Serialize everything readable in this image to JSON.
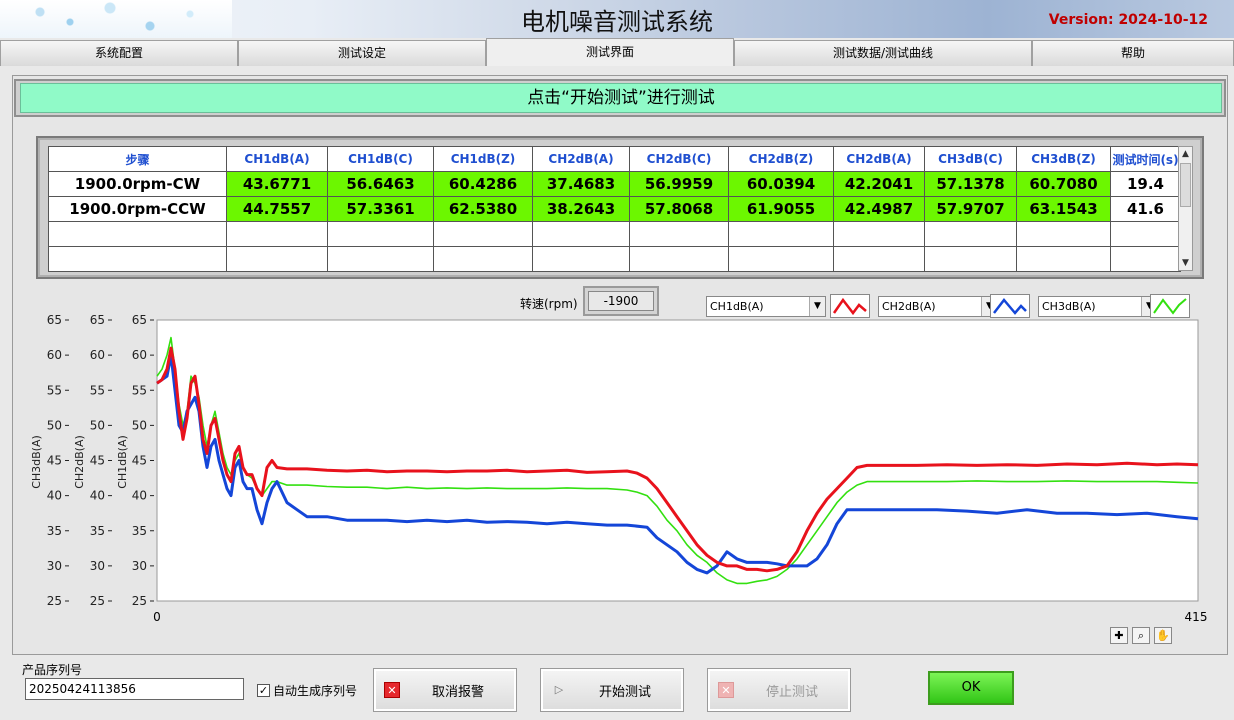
{
  "header": {
    "title": "电机噪音测试系统",
    "version": "Version: 2024-10-12"
  },
  "tabs": [
    {
      "label": "系统配置",
      "active": false
    },
    {
      "label": "测试设定",
      "active": false
    },
    {
      "label": "测试界面",
      "active": true
    },
    {
      "label": "测试数据/测试曲线",
      "active": false
    },
    {
      "label": "帮助",
      "active": false
    }
  ],
  "banner": "点击“开始测试”进行测试",
  "table": {
    "headers": [
      "步骤",
      "CH1dB(A)",
      "CH1dB(C)",
      "CH1dB(Z)",
      "CH2dB(A)",
      "CH2dB(C)",
      "CH2dB(Z)",
      "CH2dB(A)",
      "CH3dB(C)",
      "CH3dB(Z)",
      "测试时间(s)"
    ],
    "rows": [
      [
        "1900.0rpm-CW",
        "43.6771",
        "56.6463",
        "60.4286",
        "37.4683",
        "56.9959",
        "60.0394",
        "42.2041",
        "57.1378",
        "60.7080",
        "19.4"
      ],
      [
        "1900.0rpm-CCW",
        "44.7557",
        "57.3361",
        "62.5380",
        "38.2643",
        "57.8068",
        "61.9055",
        "42.4987",
        "57.9707",
        "63.1543",
        "41.6"
      ]
    ]
  },
  "speed": {
    "label": "转速(rpm)",
    "value": "-1900"
  },
  "selectors": [
    {
      "value": "CH1dB(A)",
      "color": "#e8121c"
    },
    {
      "value": "CH2dB(A)",
      "color": "#1446d8"
    },
    {
      "value": "CH3dB(A)",
      "color": "#33e010"
    }
  ],
  "chart_data": {
    "type": "line",
    "xlim": [
      0,
      415
    ],
    "ylim": [
      25,
      65
    ],
    "x_ticks": [
      "0",
      "415"
    ],
    "y_ticks": [
      "25",
      "30",
      "35",
      "40",
      "45",
      "50",
      "55",
      "60",
      "65"
    ],
    "y_axes": [
      "CH3dB(A)",
      "CH2dB(A)",
      "CH1dB(A)"
    ],
    "series": [
      {
        "name": "CH1dB(A)",
        "color": "#e8121c",
        "points": [
          [
            0,
            56
          ],
          [
            5,
            56.5
          ],
          [
            10,
            58
          ],
          [
            14,
            61
          ],
          [
            18,
            58
          ],
          [
            22,
            52
          ],
          [
            26,
            48
          ],
          [
            30,
            51
          ],
          [
            34,
            56
          ],
          [
            38,
            57
          ],
          [
            42,
            53
          ],
          [
            46,
            48
          ],
          [
            50,
            46
          ],
          [
            54,
            50
          ],
          [
            58,
            51
          ],
          [
            62,
            48
          ],
          [
            66,
            45
          ],
          [
            70,
            43
          ],
          [
            74,
            42
          ],
          [
            78,
            46
          ],
          [
            82,
            47
          ],
          [
            86,
            44
          ],
          [
            90,
            43
          ],
          [
            95,
            43
          ],
          [
            100,
            41
          ],
          [
            105,
            40
          ],
          [
            110,
            44
          ],
          [
            115,
            45
          ],
          [
            120,
            44
          ],
          [
            130,
            43.8
          ],
          [
            150,
            43.8
          ],
          [
            170,
            43.6
          ],
          [
            190,
            43.5
          ],
          [
            210,
            43.6
          ],
          [
            230,
            43.4
          ],
          [
            250,
            43.5
          ],
          [
            270,
            43.5
          ],
          [
            290,
            43.4
          ],
          [
            310,
            43.5
          ],
          [
            330,
            43.5
          ],
          [
            350,
            43.6
          ],
          [
            370,
            43.4
          ],
          [
            390,
            43.5
          ],
          [
            410,
            43.6
          ],
          [
            430,
            43.3
          ],
          [
            450,
            43.4
          ],
          [
            470,
            43.5
          ],
          [
            480,
            43.2
          ],
          [
            490,
            42.5
          ],
          [
            500,
            41
          ],
          [
            510,
            39
          ],
          [
            520,
            37
          ],
          [
            530,
            35
          ],
          [
            540,
            33
          ],
          [
            550,
            31.5
          ],
          [
            560,
            30.5
          ],
          [
            570,
            30
          ],
          [
            580,
            30
          ],
          [
            590,
            29.5
          ],
          [
            600,
            29.5
          ],
          [
            610,
            29.3
          ],
          [
            620,
            29.5
          ],
          [
            630,
            30
          ],
          [
            640,
            32
          ],
          [
            650,
            35
          ],
          [
            660,
            37.5
          ],
          [
            670,
            39.5
          ],
          [
            680,
            41
          ],
          [
            690,
            42.5
          ],
          [
            700,
            44
          ],
          [
            710,
            44.3
          ],
          [
            730,
            44.3
          ],
          [
            760,
            44.3
          ],
          [
            790,
            44.4
          ],
          [
            820,
            44.3
          ],
          [
            850,
            44.4
          ],
          [
            880,
            44.3
          ],
          [
            910,
            44.5
          ],
          [
            940,
            44.4
          ],
          [
            970,
            44.6
          ],
          [
            1000,
            44.4
          ],
          [
            1020,
            44.5
          ],
          [
            1041,
            44.4
          ]
        ]
      },
      {
        "name": "CH2dB(A)",
        "color": "#1446d8",
        "points": [
          [
            0,
            56
          ],
          [
            5,
            56.5
          ],
          [
            10,
            57
          ],
          [
            14,
            60
          ],
          [
            18,
            55
          ],
          [
            22,
            50
          ],
          [
            26,
            49
          ],
          [
            30,
            52
          ],
          [
            34,
            53
          ],
          [
            38,
            54
          ],
          [
            42,
            52
          ],
          [
            46,
            47
          ],
          [
            50,
            44
          ],
          [
            54,
            47
          ],
          [
            58,
            48
          ],
          [
            62,
            45
          ],
          [
            66,
            43
          ],
          [
            70,
            41
          ],
          [
            74,
            40
          ],
          [
            78,
            44
          ],
          [
            82,
            45
          ],
          [
            86,
            42
          ],
          [
            90,
            41
          ],
          [
            95,
            41
          ],
          [
            100,
            38
          ],
          [
            105,
            36
          ],
          [
            110,
            39
          ],
          [
            115,
            41
          ],
          [
            120,
            42
          ],
          [
            130,
            39
          ],
          [
            140,
            38
          ],
          [
            150,
            37
          ],
          [
            170,
            37
          ],
          [
            190,
            36.5
          ],
          [
            210,
            36.5
          ],
          [
            230,
            36.5
          ],
          [
            250,
            36.3
          ],
          [
            270,
            36.5
          ],
          [
            290,
            36.3
          ],
          [
            310,
            36.5
          ],
          [
            330,
            36.2
          ],
          [
            350,
            36.3
          ],
          [
            370,
            36.2
          ],
          [
            390,
            36
          ],
          [
            410,
            36.2
          ],
          [
            430,
            36
          ],
          [
            450,
            35.8
          ],
          [
            470,
            35.8
          ],
          [
            490,
            35.5
          ],
          [
            500,
            34
          ],
          [
            510,
            33
          ],
          [
            520,
            32
          ],
          [
            530,
            30.5
          ],
          [
            540,
            29.5
          ],
          [
            550,
            29
          ],
          [
            560,
            30
          ],
          [
            570,
            32
          ],
          [
            580,
            31
          ],
          [
            590,
            30.5
          ],
          [
            600,
            30.5
          ],
          [
            610,
            30.5
          ],
          [
            620,
            30.3
          ],
          [
            630,
            30
          ],
          [
            640,
            30
          ],
          [
            650,
            30
          ],
          [
            660,
            31
          ],
          [
            670,
            33
          ],
          [
            680,
            36
          ],
          [
            690,
            38
          ],
          [
            700,
            38
          ],
          [
            720,
            38
          ],
          [
            750,
            38
          ],
          [
            780,
            38
          ],
          [
            810,
            37.8
          ],
          [
            840,
            37.5
          ],
          [
            870,
            38
          ],
          [
            900,
            37.5
          ],
          [
            930,
            37.5
          ],
          [
            960,
            37.3
          ],
          [
            990,
            37.5
          ],
          [
            1020,
            37
          ],
          [
            1041,
            36.7
          ]
        ]
      },
      {
        "name": "CH3dB(A)",
        "color": "#33e010",
        "points": [
          [
            0,
            57
          ],
          [
            5,
            58
          ],
          [
            10,
            60
          ],
          [
            14,
            62.5
          ],
          [
            18,
            58
          ],
          [
            22,
            53
          ],
          [
            26,
            50
          ],
          [
            30,
            52
          ],
          [
            34,
            57
          ],
          [
            38,
            56
          ],
          [
            42,
            54
          ],
          [
            46,
            50
          ],
          [
            50,
            47
          ],
          [
            54,
            50
          ],
          [
            58,
            52
          ],
          [
            62,
            49
          ],
          [
            66,
            46
          ],
          [
            70,
            44
          ],
          [
            74,
            43
          ],
          [
            78,
            45
          ],
          [
            82,
            46
          ],
          [
            86,
            44
          ],
          [
            90,
            43
          ],
          [
            95,
            42.5
          ],
          [
            100,
            41
          ],
          [
            105,
            40
          ],
          [
            110,
            41
          ],
          [
            115,
            42
          ],
          [
            120,
            42
          ],
          [
            130,
            41.5
          ],
          [
            150,
            41.5
          ],
          [
            170,
            41.3
          ],
          [
            190,
            41.2
          ],
          [
            210,
            41.2
          ],
          [
            230,
            41
          ],
          [
            250,
            41.2
          ],
          [
            270,
            41
          ],
          [
            290,
            41.1
          ],
          [
            310,
            41
          ],
          [
            330,
            41.1
          ],
          [
            350,
            41
          ],
          [
            370,
            41
          ],
          [
            390,
            41
          ],
          [
            410,
            41.1
          ],
          [
            430,
            41
          ],
          [
            450,
            41
          ],
          [
            470,
            40.8
          ],
          [
            480,
            40.5
          ],
          [
            490,
            40
          ],
          [
            500,
            38.5
          ],
          [
            510,
            36.5
          ],
          [
            520,
            35
          ],
          [
            530,
            33
          ],
          [
            540,
            31.5
          ],
          [
            550,
            30.5
          ],
          [
            560,
            29
          ],
          [
            570,
            28
          ],
          [
            580,
            27.5
          ],
          [
            590,
            27.5
          ],
          [
            600,
            27.8
          ],
          [
            610,
            28
          ],
          [
            620,
            28.5
          ],
          [
            630,
            29.5
          ],
          [
            640,
            31
          ],
          [
            650,
            33
          ],
          [
            660,
            35
          ],
          [
            670,
            37
          ],
          [
            680,
            39
          ],
          [
            690,
            40.5
          ],
          [
            700,
            41.5
          ],
          [
            710,
            42
          ],
          [
            730,
            42
          ],
          [
            760,
            42
          ],
          [
            790,
            42
          ],
          [
            820,
            42.1
          ],
          [
            850,
            42
          ],
          [
            880,
            42
          ],
          [
            910,
            42.1
          ],
          [
            940,
            42
          ],
          [
            970,
            42
          ],
          [
            1000,
            42
          ],
          [
            1020,
            41.9
          ],
          [
            1041,
            41.8
          ]
        ]
      }
    ]
  },
  "bottom": {
    "serial_label": "产品序列号",
    "serial_value": "20250424113856",
    "auto_label": "自动生成序列号",
    "auto_checked": true,
    "cancel_alarm": "取消报警",
    "start_test": "开始测试",
    "stop_test": "停止测试",
    "ok": "OK"
  }
}
